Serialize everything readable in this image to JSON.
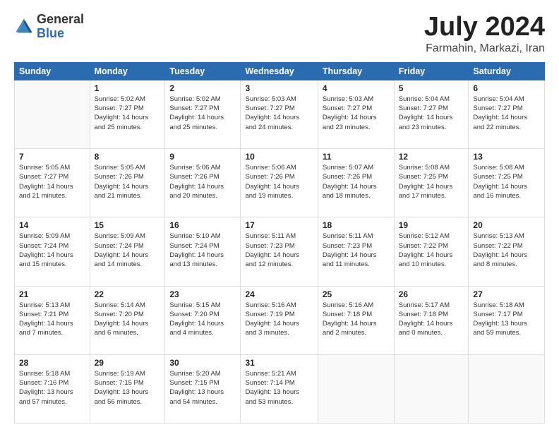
{
  "logo": {
    "general": "General",
    "blue": "Blue"
  },
  "title": {
    "month_year": "July 2024",
    "location": "Farmahin, Markazi, Iran"
  },
  "weekdays": [
    "Sunday",
    "Monday",
    "Tuesday",
    "Wednesday",
    "Thursday",
    "Friday",
    "Saturday"
  ],
  "weeks": [
    [
      {
        "day": "",
        "info": ""
      },
      {
        "day": "1",
        "info": "Sunrise: 5:02 AM\nSunset: 7:27 PM\nDaylight: 14 hours\nand 25 minutes."
      },
      {
        "day": "2",
        "info": "Sunrise: 5:02 AM\nSunset: 7:27 PM\nDaylight: 14 hours\nand 25 minutes."
      },
      {
        "day": "3",
        "info": "Sunrise: 5:03 AM\nSunset: 7:27 PM\nDaylight: 14 hours\nand 24 minutes."
      },
      {
        "day": "4",
        "info": "Sunrise: 5:03 AM\nSunset: 7:27 PM\nDaylight: 14 hours\nand 23 minutes."
      },
      {
        "day": "5",
        "info": "Sunrise: 5:04 AM\nSunset: 7:27 PM\nDaylight: 14 hours\nand 23 minutes."
      },
      {
        "day": "6",
        "info": "Sunrise: 5:04 AM\nSunset: 7:27 PM\nDaylight: 14 hours\nand 22 minutes."
      }
    ],
    [
      {
        "day": "7",
        "info": "Sunrise: 5:05 AM\nSunset: 7:27 PM\nDaylight: 14 hours\nand 21 minutes."
      },
      {
        "day": "8",
        "info": "Sunrise: 5:05 AM\nSunset: 7:26 PM\nDaylight: 14 hours\nand 21 minutes."
      },
      {
        "day": "9",
        "info": "Sunrise: 5:06 AM\nSunset: 7:26 PM\nDaylight: 14 hours\nand 20 minutes."
      },
      {
        "day": "10",
        "info": "Sunrise: 5:06 AM\nSunset: 7:26 PM\nDaylight: 14 hours\nand 19 minutes."
      },
      {
        "day": "11",
        "info": "Sunrise: 5:07 AM\nSunset: 7:26 PM\nDaylight: 14 hours\nand 18 minutes."
      },
      {
        "day": "12",
        "info": "Sunrise: 5:08 AM\nSunset: 7:25 PM\nDaylight: 14 hours\nand 17 minutes."
      },
      {
        "day": "13",
        "info": "Sunrise: 5:08 AM\nSunset: 7:25 PM\nDaylight: 14 hours\nand 16 minutes."
      }
    ],
    [
      {
        "day": "14",
        "info": "Sunrise: 5:09 AM\nSunset: 7:24 PM\nDaylight: 14 hours\nand 15 minutes."
      },
      {
        "day": "15",
        "info": "Sunrise: 5:09 AM\nSunset: 7:24 PM\nDaylight: 14 hours\nand 14 minutes."
      },
      {
        "day": "16",
        "info": "Sunrise: 5:10 AM\nSunset: 7:24 PM\nDaylight: 14 hours\nand 13 minutes."
      },
      {
        "day": "17",
        "info": "Sunrise: 5:11 AM\nSunset: 7:23 PM\nDaylight: 14 hours\nand 12 minutes."
      },
      {
        "day": "18",
        "info": "Sunrise: 5:11 AM\nSunset: 7:23 PM\nDaylight: 14 hours\nand 11 minutes."
      },
      {
        "day": "19",
        "info": "Sunrise: 5:12 AM\nSunset: 7:22 PM\nDaylight: 14 hours\nand 10 minutes."
      },
      {
        "day": "20",
        "info": "Sunrise: 5:13 AM\nSunset: 7:22 PM\nDaylight: 14 hours\nand 8 minutes."
      }
    ],
    [
      {
        "day": "21",
        "info": "Sunrise: 5:13 AM\nSunset: 7:21 PM\nDaylight: 14 hours\nand 7 minutes."
      },
      {
        "day": "22",
        "info": "Sunrise: 5:14 AM\nSunset: 7:20 PM\nDaylight: 14 hours\nand 6 minutes."
      },
      {
        "day": "23",
        "info": "Sunrise: 5:15 AM\nSunset: 7:20 PM\nDaylight: 14 hours\nand 4 minutes."
      },
      {
        "day": "24",
        "info": "Sunrise: 5:16 AM\nSunset: 7:19 PM\nDaylight: 14 hours\nand 3 minutes."
      },
      {
        "day": "25",
        "info": "Sunrise: 5:16 AM\nSunset: 7:18 PM\nDaylight: 14 hours\nand 2 minutes."
      },
      {
        "day": "26",
        "info": "Sunrise: 5:17 AM\nSunset: 7:18 PM\nDaylight: 14 hours\nand 0 minutes."
      },
      {
        "day": "27",
        "info": "Sunrise: 5:18 AM\nSunset: 7:17 PM\nDaylight: 13 hours\nand 59 minutes."
      }
    ],
    [
      {
        "day": "28",
        "info": "Sunrise: 5:18 AM\nSunset: 7:16 PM\nDaylight: 13 hours\nand 57 minutes."
      },
      {
        "day": "29",
        "info": "Sunrise: 5:19 AM\nSunset: 7:15 PM\nDaylight: 13 hours\nand 56 minutes."
      },
      {
        "day": "30",
        "info": "Sunrise: 5:20 AM\nSunset: 7:15 PM\nDaylight: 13 hours\nand 54 minutes."
      },
      {
        "day": "31",
        "info": "Sunrise: 5:21 AM\nSunset: 7:14 PM\nDaylight: 13 hours\nand 53 minutes."
      },
      {
        "day": "",
        "info": ""
      },
      {
        "day": "",
        "info": ""
      },
      {
        "day": "",
        "info": ""
      }
    ]
  ]
}
